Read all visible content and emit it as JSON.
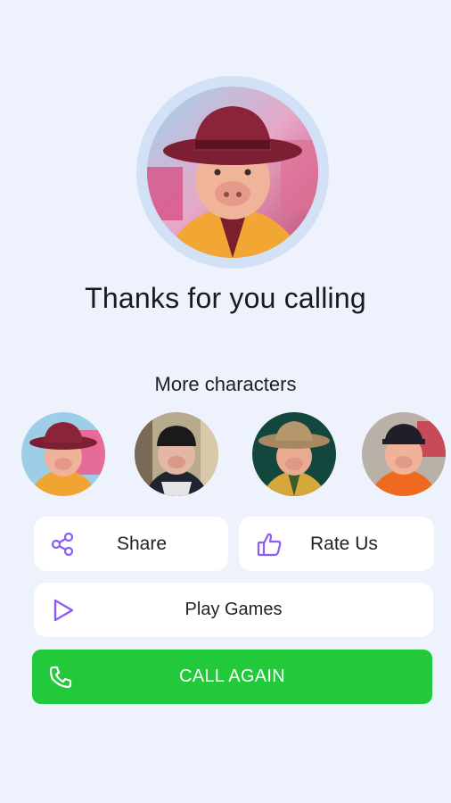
{
  "hero": {
    "image": "character-portrait-pig-man-red-hat"
  },
  "title": "Thanks for you calling",
  "more_title": "More characters",
  "characters": [
    {
      "image": "character-red-hat"
    },
    {
      "image": "character-black-beanie"
    },
    {
      "image": "character-cowboy-hat"
    },
    {
      "image": "character-red-shirt"
    }
  ],
  "actions": {
    "share": {
      "label": "Share",
      "icon": "share-icon"
    },
    "rate": {
      "label": "Rate Us",
      "icon": "thumbs-up-icon"
    },
    "games": {
      "label": "Play Games",
      "icon": "play-icon"
    },
    "call": {
      "label": "CALL AGAIN",
      "icon": "phone-icon"
    }
  },
  "colors": {
    "background": "#eef2fd",
    "accent": "#8b5cf6",
    "call_green": "#22c93a"
  }
}
